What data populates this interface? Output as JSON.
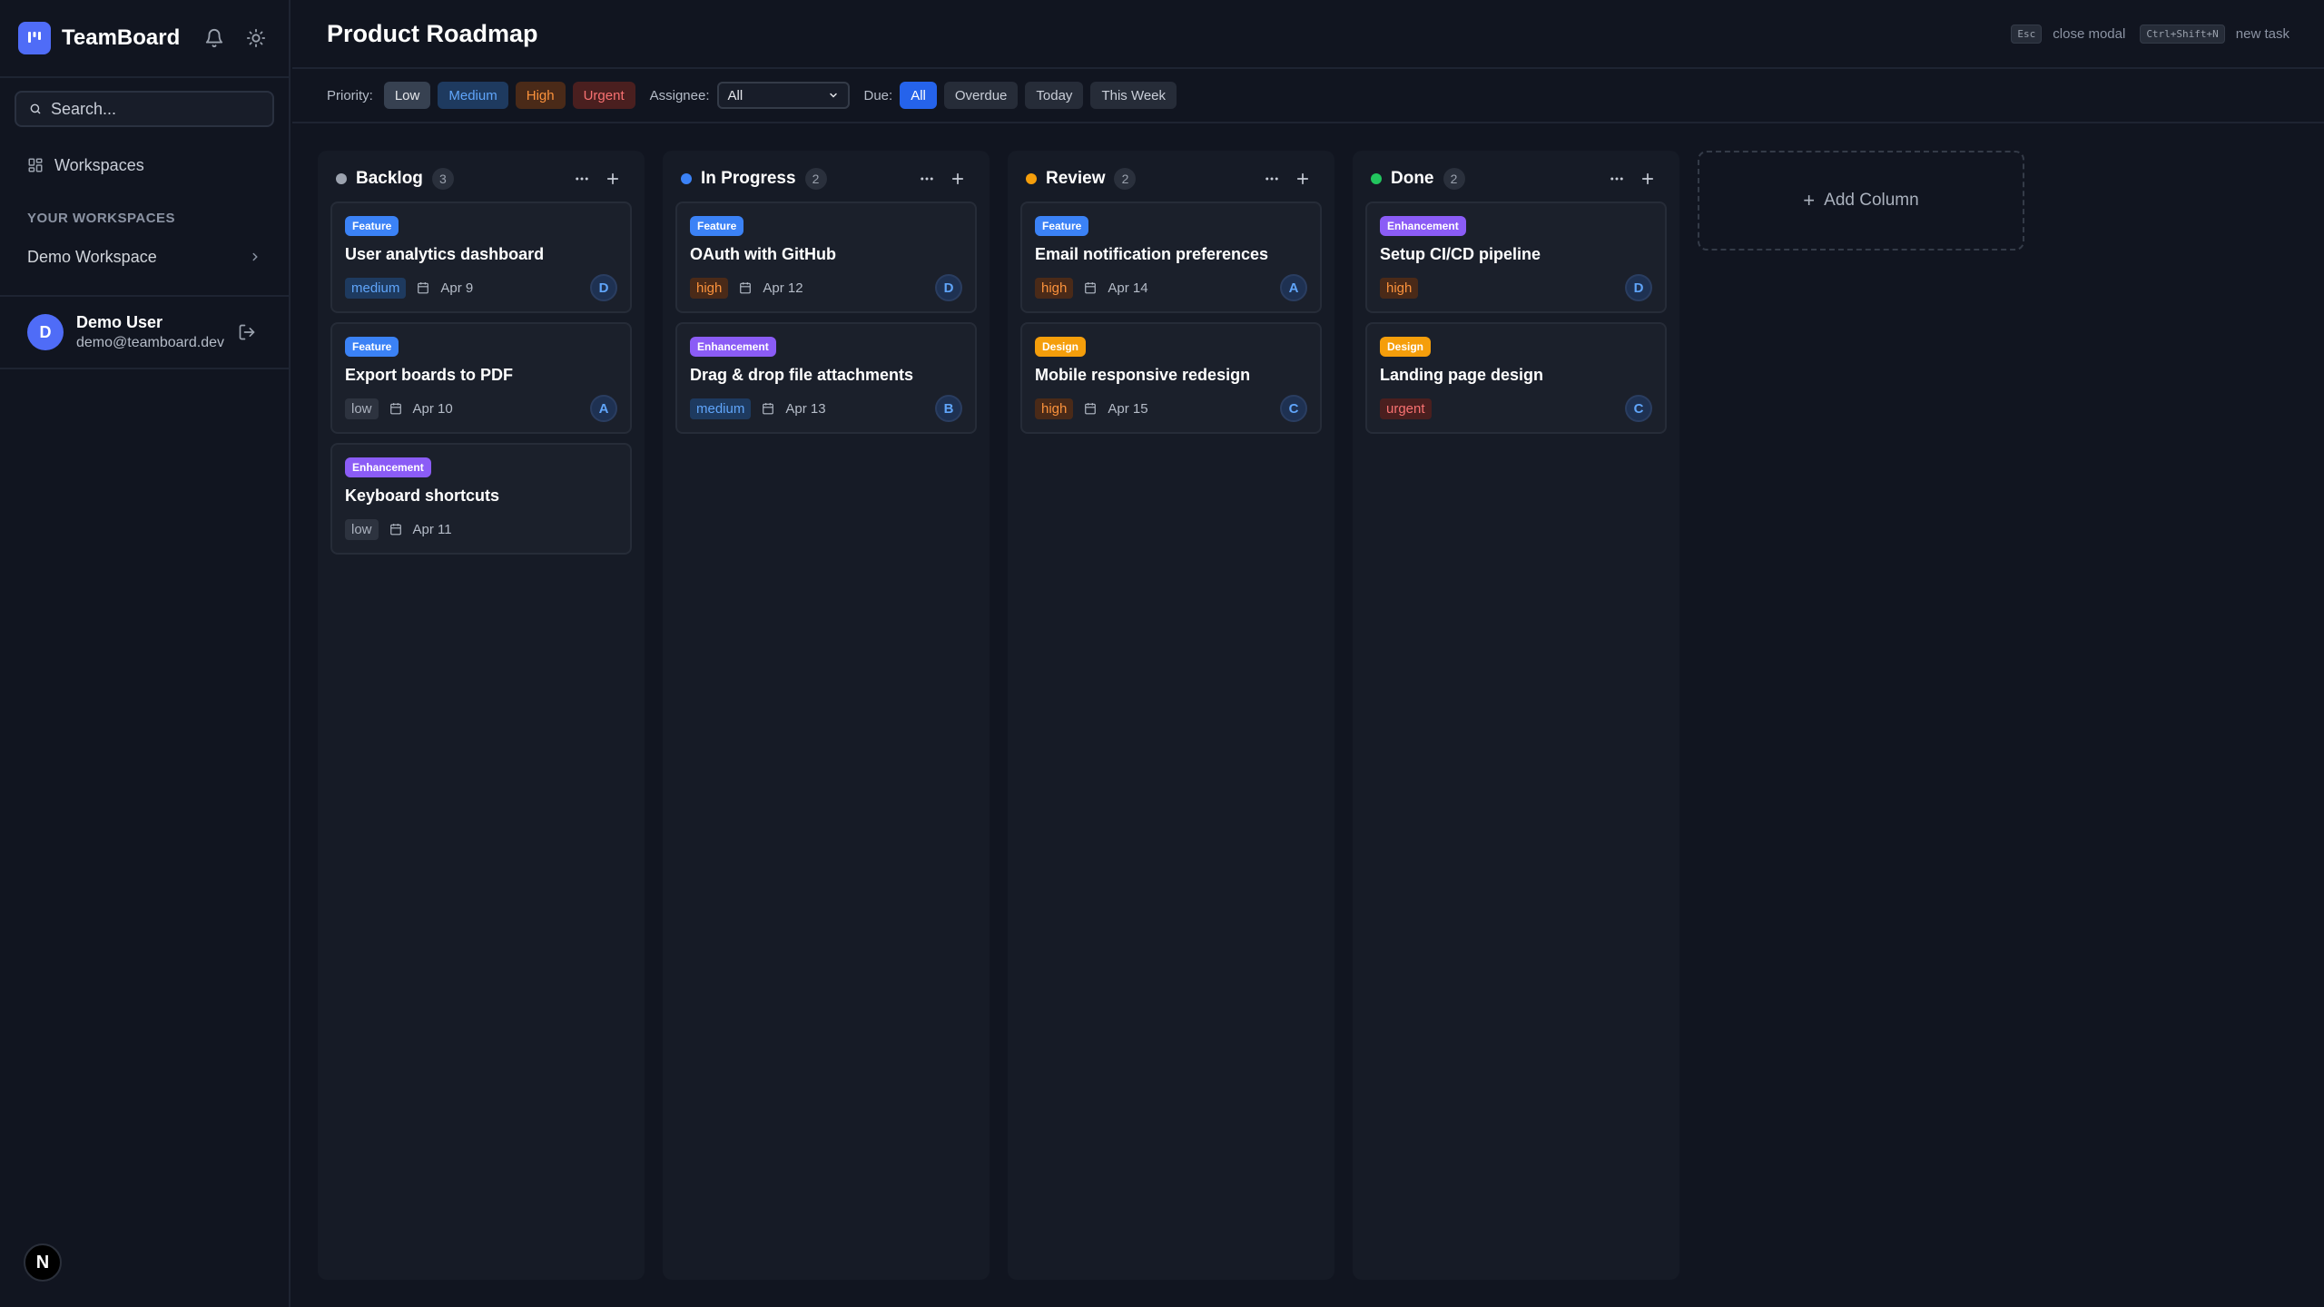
{
  "app": {
    "name": "TeamBoard"
  },
  "sidebar": {
    "search_placeholder": "Search...",
    "nav_workspaces": "Workspaces",
    "section_title": "YOUR WORKSPACES",
    "workspace": "Demo Workspace",
    "user": {
      "initial": "D",
      "name": "Demo User",
      "email": "demo@teamboard.dev"
    },
    "framework_badge": "N"
  },
  "header": {
    "title": "Product Roadmap",
    "shortcuts": [
      {
        "key": "Esc",
        "label": "close modal"
      },
      {
        "key": "Ctrl+Shift+N",
        "label": "new task"
      }
    ]
  },
  "filters": {
    "priority_label": "Priority:",
    "priorities": [
      "Low",
      "Medium",
      "High",
      "Urgent"
    ],
    "assignee_label": "Assignee:",
    "assignee_value": "All",
    "due_label": "Due:",
    "due_options": [
      "All",
      "Overdue",
      "Today",
      "This Week"
    ],
    "due_selected": "All"
  },
  "colors": {
    "accent": "#4f6cf7",
    "backlog": "#9ca3af",
    "in_progress": "#3b82f6",
    "review": "#f59e0b",
    "done": "#22c55e",
    "feature": "#3b82f6",
    "enhancement": "#8b5cf6",
    "design": "#f59e0b"
  },
  "columns": [
    {
      "name": "Backlog",
      "count": "3",
      "cards": [
        {
          "tag": "Feature",
          "title": "User analytics dashboard",
          "priority": "medium",
          "due": "Apr 9",
          "assignee": "D"
        },
        {
          "tag": "Feature",
          "title": "Export boards to PDF",
          "priority": "low",
          "due": "Apr 10",
          "assignee": "A"
        },
        {
          "tag": "Enhancement",
          "title": "Keyboard shortcuts",
          "priority": "low",
          "due": "Apr 11",
          "assignee": ""
        }
      ]
    },
    {
      "name": "In Progress",
      "count": "2",
      "cards": [
        {
          "tag": "Feature",
          "title": "OAuth with GitHub",
          "priority": "high",
          "due": "Apr 12",
          "assignee": "D"
        },
        {
          "tag": "Enhancement",
          "title": "Drag & drop file attachments",
          "priority": "medium",
          "due": "Apr 13",
          "assignee": "B"
        }
      ]
    },
    {
      "name": "Review",
      "count": "2",
      "cards": [
        {
          "tag": "Feature",
          "title": "Email notification preferences",
          "priority": "high",
          "due": "Apr 14",
          "assignee": "A"
        },
        {
          "tag": "Design",
          "title": "Mobile responsive redesign",
          "priority": "high",
          "due": "Apr 15",
          "assignee": "C"
        }
      ]
    },
    {
      "name": "Done",
      "count": "2",
      "cards": [
        {
          "tag": "Enhancement",
          "title": "Setup CI/CD pipeline",
          "priority": "high",
          "due": "",
          "assignee": "D"
        },
        {
          "tag": "Design",
          "title": "Landing page design",
          "priority": "urgent",
          "due": "",
          "assignee": "C"
        }
      ]
    }
  ],
  "add_column_label": "Add Column"
}
